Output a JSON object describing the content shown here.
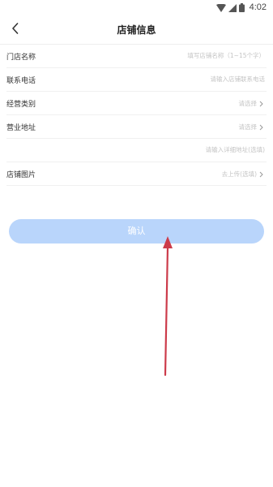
{
  "status_bar": {
    "time": "4:02"
  },
  "header": {
    "title": "店铺信息",
    "back_icon": "chevron-left-icon"
  },
  "form": {
    "rows": [
      {
        "label": "门店名称",
        "placeholder": "填写店铺名称（1~15个字）",
        "type": "input"
      },
      {
        "label": "联系电话",
        "placeholder": "请输入店铺联系电话",
        "type": "input"
      },
      {
        "label": "经营类别",
        "value": "请选择",
        "type": "select"
      },
      {
        "label": "营业地址",
        "value": "请选择",
        "type": "select"
      },
      {
        "label": "",
        "placeholder": "请输入详细地址(选填)",
        "type": "input"
      },
      {
        "label": "店铺图片",
        "value": "去上传(选填)",
        "type": "select"
      }
    ]
  },
  "confirm_button": {
    "label": "确认"
  },
  "colors": {
    "button_bg": "#b9d5fb",
    "arrow": "#cc3b4a",
    "placeholder": "#c4c4c4"
  }
}
